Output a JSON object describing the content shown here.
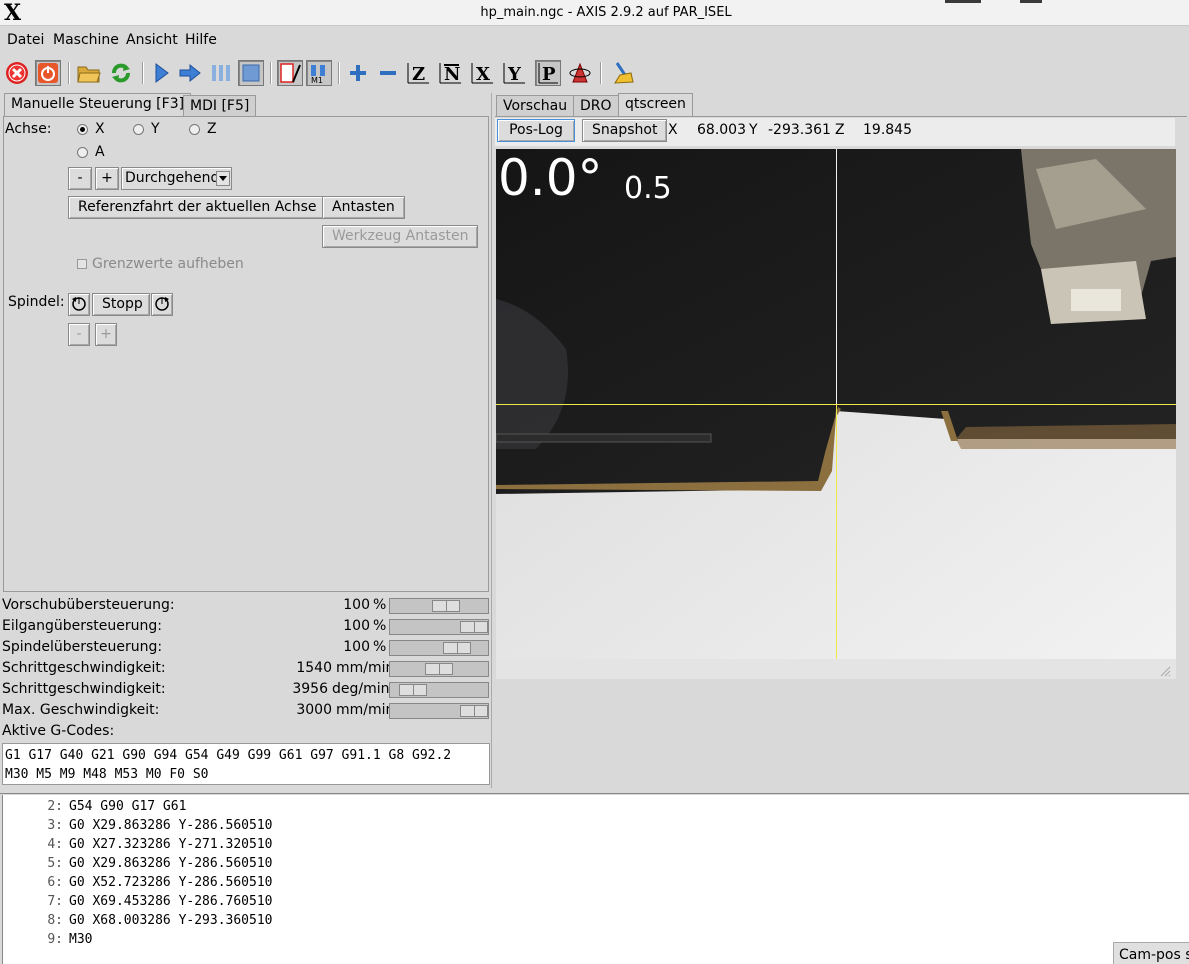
{
  "window": {
    "title": "hp_main.ngc - AXIS 2.9.2 auf PAR_ISEL",
    "logo": "X"
  },
  "menu": [
    "Datei",
    "Maschine",
    "Ansicht",
    "Hilfe"
  ],
  "toolbar_icons": [
    "estop-icon",
    "power-icon",
    "open-file-icon",
    "reload-icon",
    "run-icon",
    "step-icon",
    "pause-icon",
    "stop-icon",
    "block-delete-icon",
    "optional-stop-icon",
    "zoom-in-icon",
    "zoom-out-icon",
    "view-z-icon",
    "view-z2-icon",
    "view-x-icon",
    "view-y-icon",
    "view-p-icon",
    "rotate-icon",
    "clear-plot-icon"
  ],
  "left_tabs": [
    "Manuelle Steuerung [F3]",
    "MDI [F5]"
  ],
  "manual": {
    "axis_label": "Achse:",
    "axes": [
      {
        "label": "X",
        "selected": true
      },
      {
        "label": "Y",
        "selected": false
      },
      {
        "label": "Z",
        "selected": false
      },
      {
        "label": "A",
        "selected": false
      }
    ],
    "minus": "-",
    "plus": "+",
    "jog_mode": "Durchgehend",
    "home_button": "Referenzfahrt der aktuellen Achse",
    "touch_off_button": "Antasten",
    "tool_touch_off_button": "Werkzeug Antasten",
    "override_limits": "Grenzwerte aufheben",
    "spindle_label": "Spindel:",
    "spindle_stop": "Stopp",
    "spindle_minus": "-",
    "spindle_plus": "+"
  },
  "overrides": [
    {
      "label": "Vorschubübersteuerung:",
      "value": "100",
      "unit": "%",
      "level": 0.6
    },
    {
      "label": "Eilgangübersteuerung:",
      "value": "100",
      "unit": "%",
      "level": 1.0
    },
    {
      "label": "Spindelübersteuerung:",
      "value": "100",
      "unit": "%",
      "level": 0.75
    },
    {
      "label": "Schrittgeschwindigkeit:",
      "value": "1540",
      "unit": "mm/min",
      "level": 0.5
    },
    {
      "label": "Schrittgeschwindigkeit:",
      "value": "3956",
      "unit": "deg/min",
      "level": 0.13
    },
    {
      "label": "Max. Geschwindigkeit:",
      "value": "3000",
      "unit": "mm/min",
      "level": 1.0
    }
  ],
  "active_gcodes_label": "Aktive G-Codes:",
  "active_gcodes": [
    "G1 G17 G40 G21 G90 G94 G54 G49 G99 G61 G97 G91.1 G8 G92.2",
    "M30 M5 M9 M48 M53 M0 F0 S0"
  ],
  "right_tabs": [
    "Vorschau",
    "DRO",
    "qtscreen"
  ],
  "qtscreen": {
    "poslog_button": "Pos-Log",
    "snapshot_button": "Snapshot",
    "x_label": "X",
    "x_value": "68.003",
    "y_label": "Y",
    "y_value": "-293.361",
    "z_label": "Z",
    "z_value": "19.845",
    "angle": "0.0°",
    "scale": "0.5"
  },
  "gcode_lines": [
    {
      "n": "2:",
      "code": "G54 G90 G17 G61"
    },
    {
      "n": "3:",
      "code": "G0 X29.863286 Y-286.560510"
    },
    {
      "n": "4:",
      "code": "G0 X27.323286 Y-271.320510"
    },
    {
      "n": "5:",
      "code": "G0 X29.863286 Y-286.560510"
    },
    {
      "n": "6:",
      "code": "G0 X52.723286 Y-286.560510"
    },
    {
      "n": "7:",
      "code": "G0 X69.453286 Y-286.760510"
    },
    {
      "n": "8:",
      "code": "G0 X68.003286 Y-293.360510"
    },
    {
      "n": "9:",
      "code": "M30"
    }
  ],
  "status_bar": "Cam-pos st"
}
